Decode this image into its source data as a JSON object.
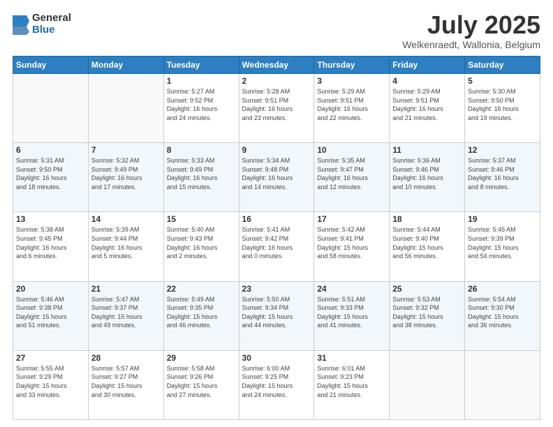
{
  "header": {
    "logo_general": "General",
    "logo_blue": "Blue",
    "month": "July 2025",
    "location": "Welkenraedt, Wallonia, Belgium"
  },
  "weekdays": [
    "Sunday",
    "Monday",
    "Tuesday",
    "Wednesday",
    "Thursday",
    "Friday",
    "Saturday"
  ],
  "weeks": [
    [
      {
        "day": "",
        "lines": []
      },
      {
        "day": "",
        "lines": []
      },
      {
        "day": "1",
        "lines": [
          "Sunrise: 5:27 AM",
          "Sunset: 9:52 PM",
          "Daylight: 16 hours",
          "and 24 minutes."
        ]
      },
      {
        "day": "2",
        "lines": [
          "Sunrise: 5:28 AM",
          "Sunset: 9:51 PM",
          "Daylight: 16 hours",
          "and 23 minutes."
        ]
      },
      {
        "day": "3",
        "lines": [
          "Sunrise: 5:29 AM",
          "Sunset: 9:51 PM",
          "Daylight: 16 hours",
          "and 22 minutes."
        ]
      },
      {
        "day": "4",
        "lines": [
          "Sunrise: 5:29 AM",
          "Sunset: 9:51 PM",
          "Daylight: 16 hours",
          "and 21 minutes."
        ]
      },
      {
        "day": "5",
        "lines": [
          "Sunrise: 5:30 AM",
          "Sunset: 9:50 PM",
          "Daylight: 16 hours",
          "and 19 minutes."
        ]
      }
    ],
    [
      {
        "day": "6",
        "lines": [
          "Sunrise: 5:31 AM",
          "Sunset: 9:50 PM",
          "Daylight: 16 hours",
          "and 18 minutes."
        ]
      },
      {
        "day": "7",
        "lines": [
          "Sunrise: 5:32 AM",
          "Sunset: 9:49 PM",
          "Daylight: 16 hours",
          "and 17 minutes."
        ]
      },
      {
        "day": "8",
        "lines": [
          "Sunrise: 5:33 AM",
          "Sunset: 9:49 PM",
          "Daylight: 16 hours",
          "and 15 minutes."
        ]
      },
      {
        "day": "9",
        "lines": [
          "Sunrise: 5:34 AM",
          "Sunset: 9:48 PM",
          "Daylight: 16 hours",
          "and 14 minutes."
        ]
      },
      {
        "day": "10",
        "lines": [
          "Sunrise: 5:35 AM",
          "Sunset: 9:47 PM",
          "Daylight: 16 hours",
          "and 12 minutes."
        ]
      },
      {
        "day": "11",
        "lines": [
          "Sunrise: 5:36 AM",
          "Sunset: 9:46 PM",
          "Daylight: 16 hours",
          "and 10 minutes."
        ]
      },
      {
        "day": "12",
        "lines": [
          "Sunrise: 5:37 AM",
          "Sunset: 9:46 PM",
          "Daylight: 16 hours",
          "and 8 minutes."
        ]
      }
    ],
    [
      {
        "day": "13",
        "lines": [
          "Sunrise: 5:38 AM",
          "Sunset: 9:45 PM",
          "Daylight: 16 hours",
          "and 6 minutes."
        ]
      },
      {
        "day": "14",
        "lines": [
          "Sunrise: 5:39 AM",
          "Sunset: 9:44 PM",
          "Daylight: 16 hours",
          "and 5 minutes."
        ]
      },
      {
        "day": "15",
        "lines": [
          "Sunrise: 5:40 AM",
          "Sunset: 9:43 PM",
          "Daylight: 16 hours",
          "and 2 minutes."
        ]
      },
      {
        "day": "16",
        "lines": [
          "Sunrise: 5:41 AM",
          "Sunset: 9:42 PM",
          "Daylight: 16 hours",
          "and 0 minutes."
        ]
      },
      {
        "day": "17",
        "lines": [
          "Sunrise: 5:42 AM",
          "Sunset: 9:41 PM",
          "Daylight: 15 hours",
          "and 58 minutes."
        ]
      },
      {
        "day": "18",
        "lines": [
          "Sunrise: 5:44 AM",
          "Sunset: 9:40 PM",
          "Daylight: 15 hours",
          "and 56 minutes."
        ]
      },
      {
        "day": "19",
        "lines": [
          "Sunrise: 5:45 AM",
          "Sunset: 9:39 PM",
          "Daylight: 15 hours",
          "and 54 minutes."
        ]
      }
    ],
    [
      {
        "day": "20",
        "lines": [
          "Sunrise: 5:46 AM",
          "Sunset: 9:38 PM",
          "Daylight: 15 hours",
          "and 51 minutes."
        ]
      },
      {
        "day": "21",
        "lines": [
          "Sunrise: 5:47 AM",
          "Sunset: 9:37 PM",
          "Daylight: 15 hours",
          "and 49 minutes."
        ]
      },
      {
        "day": "22",
        "lines": [
          "Sunrise: 5:49 AM",
          "Sunset: 9:35 PM",
          "Daylight: 15 hours",
          "and 46 minutes."
        ]
      },
      {
        "day": "23",
        "lines": [
          "Sunrise: 5:50 AM",
          "Sunset: 9:34 PM",
          "Daylight: 15 hours",
          "and 44 minutes."
        ]
      },
      {
        "day": "24",
        "lines": [
          "Sunrise: 5:51 AM",
          "Sunset: 9:33 PM",
          "Daylight: 15 hours",
          "and 41 minutes."
        ]
      },
      {
        "day": "25",
        "lines": [
          "Sunrise: 5:53 AM",
          "Sunset: 9:32 PM",
          "Daylight: 15 hours",
          "and 38 minutes."
        ]
      },
      {
        "day": "26",
        "lines": [
          "Sunrise: 5:54 AM",
          "Sunset: 9:30 PM",
          "Daylight: 15 hours",
          "and 36 minutes."
        ]
      }
    ],
    [
      {
        "day": "27",
        "lines": [
          "Sunrise: 5:55 AM",
          "Sunset: 9:29 PM",
          "Daylight: 15 hours",
          "and 33 minutes."
        ]
      },
      {
        "day": "28",
        "lines": [
          "Sunrise: 5:57 AM",
          "Sunset: 9:27 PM",
          "Daylight: 15 hours",
          "and 30 minutes."
        ]
      },
      {
        "day": "29",
        "lines": [
          "Sunrise: 5:58 AM",
          "Sunset: 9:26 PM",
          "Daylight: 15 hours",
          "and 27 minutes."
        ]
      },
      {
        "day": "30",
        "lines": [
          "Sunrise: 6:00 AM",
          "Sunset: 9:25 PM",
          "Daylight: 15 hours",
          "and 24 minutes."
        ]
      },
      {
        "day": "31",
        "lines": [
          "Sunrise: 6:01 AM",
          "Sunset: 9:23 PM",
          "Daylight: 15 hours",
          "and 21 minutes."
        ]
      },
      {
        "day": "",
        "lines": []
      },
      {
        "day": "",
        "lines": []
      }
    ]
  ]
}
